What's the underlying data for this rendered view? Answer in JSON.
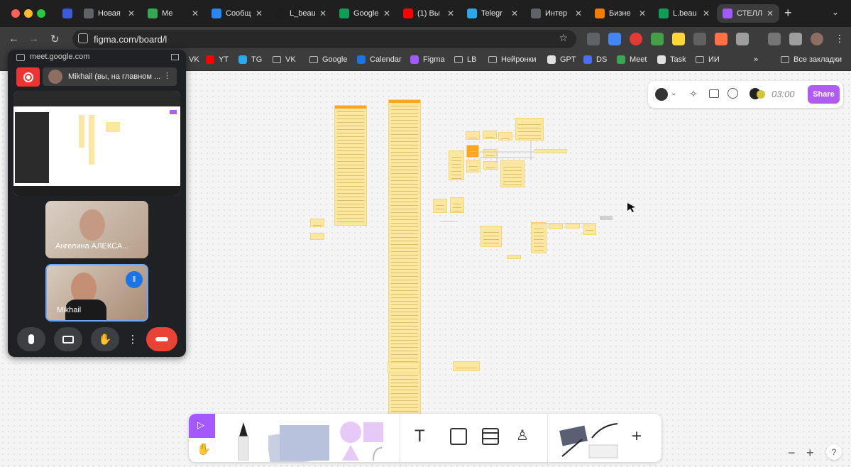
{
  "browser": {
    "tabs": [
      {
        "label": "",
        "color": "#3b5bdb",
        "icon": "copilot-icon"
      },
      {
        "label": "Новая",
        "color": "#5f6368",
        "icon": "chrome-icon"
      },
      {
        "label": "Ме",
        "color": "#34a853",
        "icon": "meet-icon"
      },
      {
        "label": "Сообщ",
        "color": "#2787f5",
        "icon": "vk-icon"
      },
      {
        "label": "L_beau",
        "color": "#1e1e1e",
        "icon": "lbeau-icon"
      },
      {
        "label": "Google",
        "color": "#0f9d58",
        "icon": "sheets-icon"
      },
      {
        "label": "(1) Вы",
        "color": "#ff0000",
        "icon": "youtube-icon"
      },
      {
        "label": "Telegr",
        "color": "#29a9eb",
        "icon": "telegram-icon"
      },
      {
        "label": "Интер",
        "color": "#5f6368",
        "icon": "globe-icon"
      },
      {
        "label": "Бизне",
        "color": "#f57c00",
        "icon": "business-icon"
      },
      {
        "label": "L.beau",
        "color": "#0f9d58",
        "icon": "sheets-icon"
      },
      {
        "label": "СТЕЛЛ",
        "color": "#a259ff",
        "icon": "figma-icon"
      }
    ],
    "url": "figma.com/board/l",
    "bookmarks": [
      "VK",
      "YT",
      "TG",
      "VK",
      "Google",
      "Calendar",
      "Figma",
      "LB",
      "Нейронки",
      "GPT",
      "DS",
      "Meet",
      "Task",
      "ИИ"
    ],
    "more_bookmarks": "»",
    "all_bookmarks": "Все закладки"
  },
  "meet": {
    "url": "meet.google.com",
    "speaker_label": "Mikhail (вы, на главном ...",
    "participants": [
      {
        "name": "Ангелина АЛЕКСА..."
      },
      {
        "name": "Mikhail"
      }
    ]
  },
  "figma": {
    "timer": "03:00",
    "share_label": "Share"
  },
  "zoom": {
    "minus": "−",
    "plus": "+",
    "help": "?"
  }
}
